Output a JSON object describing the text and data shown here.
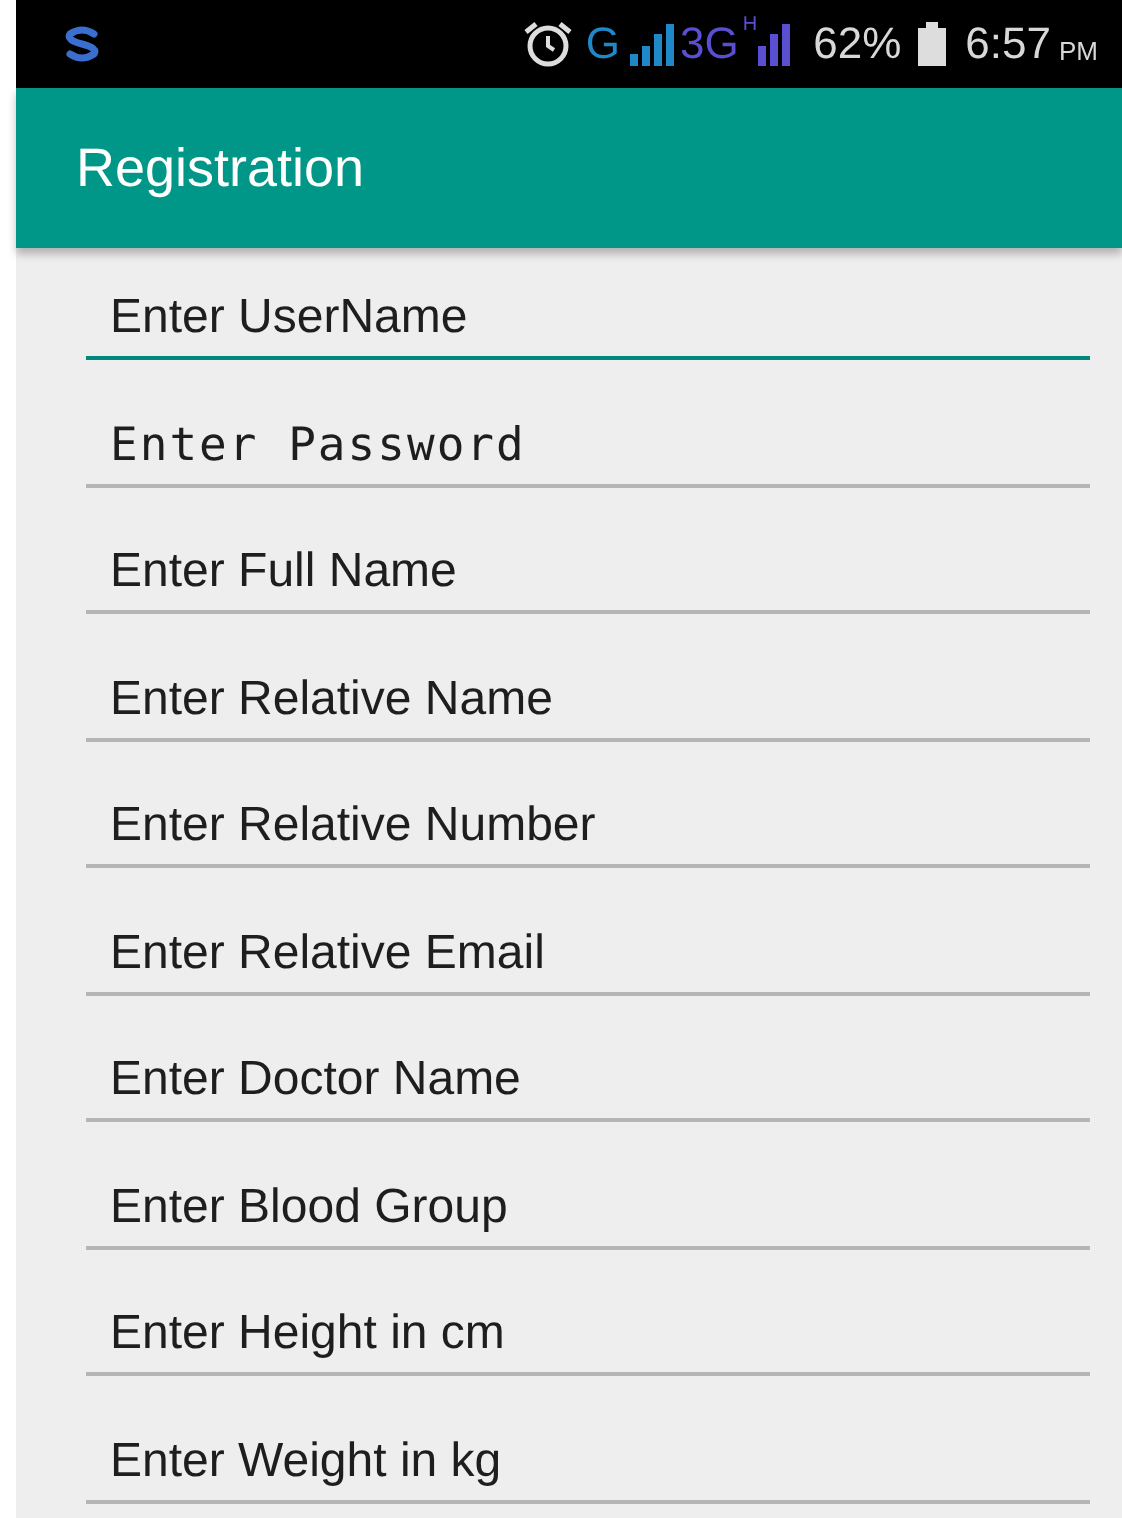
{
  "status_bar": {
    "network": "G",
    "network_2": "3G",
    "network_3": "H",
    "battery": "62%",
    "time": "6:57",
    "period": "PM"
  },
  "toolbar": {
    "title": "Registration"
  },
  "fields": [
    {
      "kind": "text",
      "placeholder": "Enter UserName",
      "focused": true
    },
    {
      "kind": "password",
      "placeholder": "Enter Password",
      "focused": false
    },
    {
      "kind": "text",
      "placeholder": "Enter Full Name",
      "focused": false
    },
    {
      "kind": "text",
      "placeholder": "Enter Relative Name",
      "focused": false
    },
    {
      "kind": "text",
      "placeholder": "Enter Relative Number",
      "focused": false
    },
    {
      "kind": "text",
      "placeholder": "Enter Relative Email",
      "focused": false
    },
    {
      "kind": "text",
      "placeholder": "Enter Doctor Name",
      "focused": false
    },
    {
      "kind": "text",
      "placeholder": "Enter Blood Group",
      "focused": false
    },
    {
      "kind": "text",
      "placeholder": "Enter Height in cm",
      "focused": false
    },
    {
      "kind": "text",
      "placeholder": "Enter Weight in kg",
      "focused": false
    }
  ]
}
